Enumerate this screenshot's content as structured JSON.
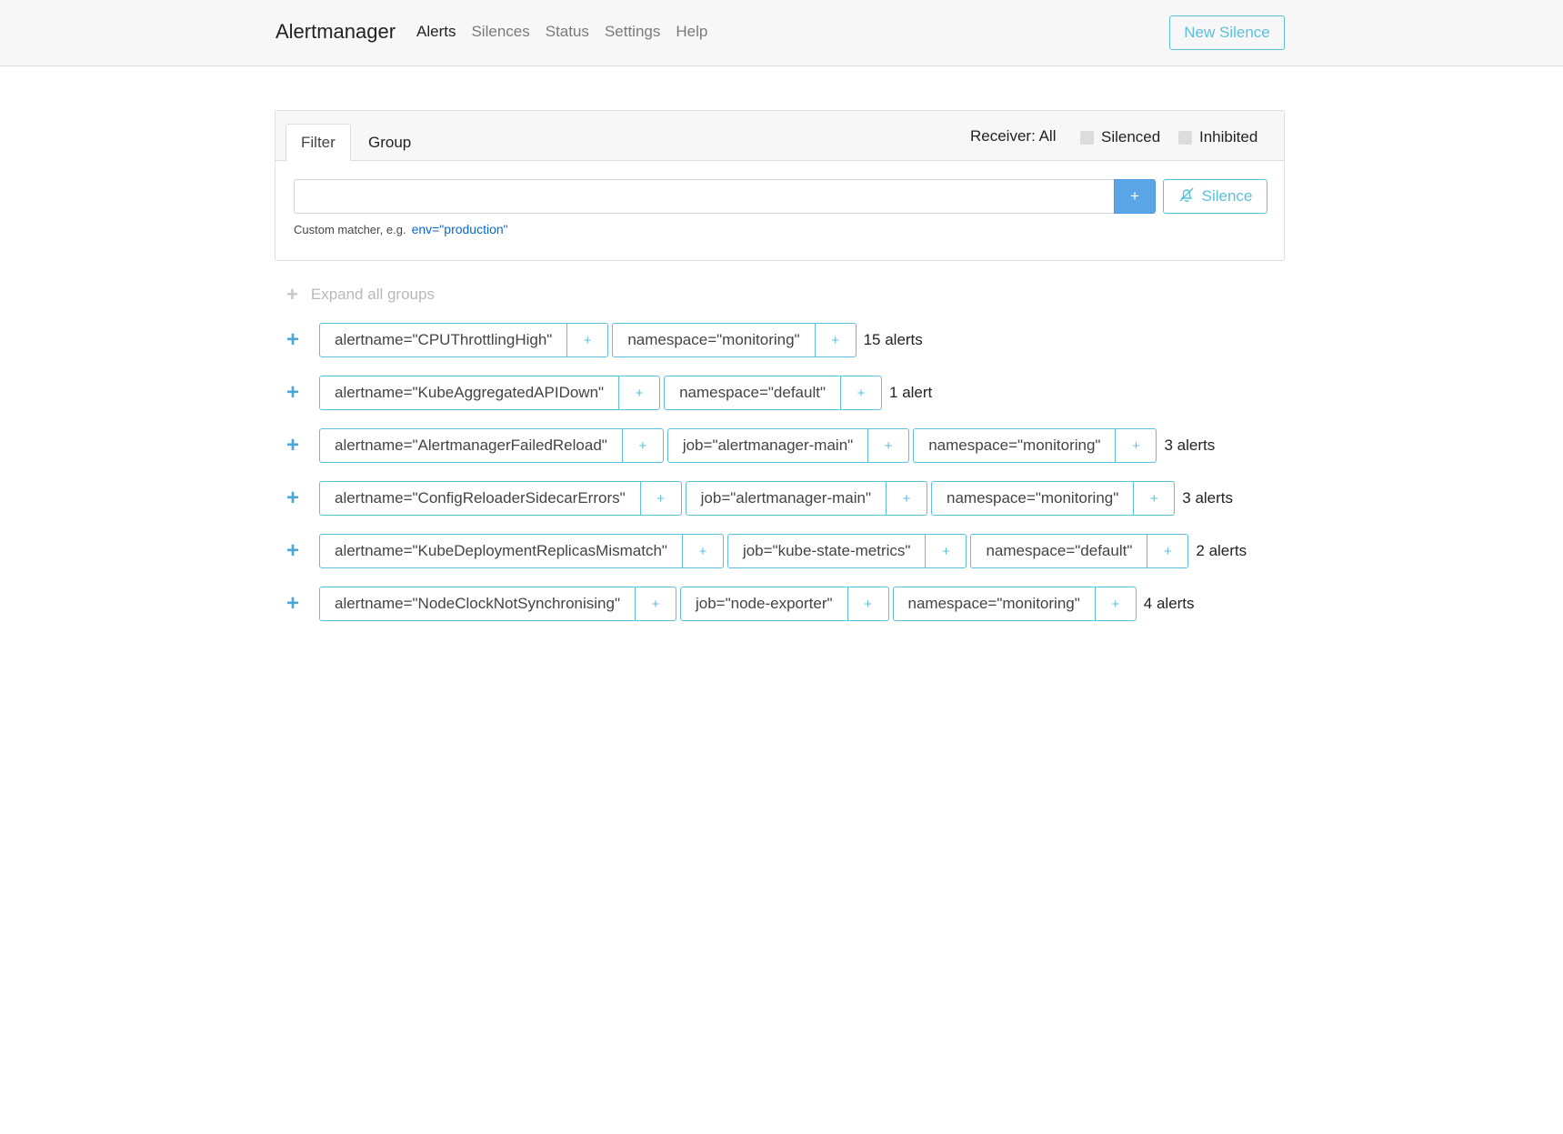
{
  "nav": {
    "brand": "Alertmanager",
    "links": [
      "Alerts",
      "Silences",
      "Status",
      "Settings",
      "Help"
    ],
    "new_silence": "New Silence"
  },
  "filter": {
    "tab_filter": "Filter",
    "tab_group": "Group",
    "receiver": "Receiver: All",
    "silenced": "Silenced",
    "inhibited": "Inhibited",
    "input_value": "",
    "add_label": "+",
    "silence_label": "Silence",
    "hint": "Custom matcher, e.g.",
    "hint_code": "env=\"production\""
  },
  "expand_all": "Expand all groups",
  "groups": [
    {
      "labels": [
        "alertname=\"CPUThrottlingHigh\"",
        "namespace=\"monitoring\""
      ],
      "count": "15 alerts"
    },
    {
      "labels": [
        "alertname=\"KubeAggregatedAPIDown\"",
        "namespace=\"default\""
      ],
      "count": "1 alert"
    },
    {
      "labels": [
        "alertname=\"AlertmanagerFailedReload\"",
        "job=\"alertmanager-main\"",
        "namespace=\"monitoring\""
      ],
      "count": "3 alerts"
    },
    {
      "labels": [
        "alertname=\"ConfigReloaderSidecarErrors\"",
        "job=\"alertmanager-main\"",
        "namespace=\"monitoring\""
      ],
      "count": "3 alerts"
    },
    {
      "labels": [
        "alertname=\"KubeDeploymentReplicasMismatch\"",
        "job=\"kube-state-metrics\"",
        "namespace=\"default\""
      ],
      "count": "2 alerts"
    },
    {
      "labels": [
        "alertname=\"NodeClockNotSynchronising\"",
        "job=\"node-exporter\"",
        "namespace=\"monitoring\""
      ],
      "count": "4 alerts"
    }
  ],
  "colors": {
    "accent": "#5bc0de",
    "primary": "#5aa5e6",
    "navbar_bg": "#f7f7f7"
  }
}
